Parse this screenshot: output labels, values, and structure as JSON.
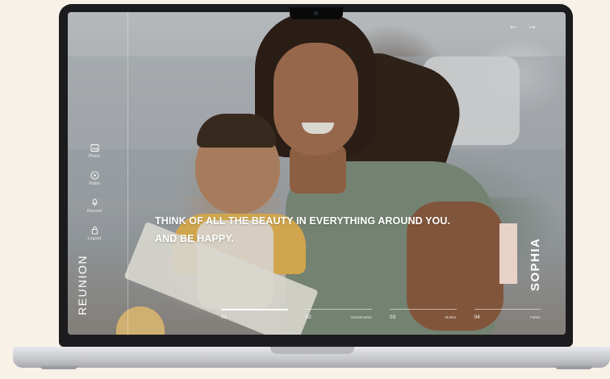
{
  "navigation": {
    "prev_icon": "arrow-left-icon",
    "next_icon": "arrow-right-icon"
  },
  "sidebar": {
    "items": [
      {
        "label": "Photo",
        "icon": "photo-icon"
      },
      {
        "label": "Video",
        "icon": "play-icon"
      },
      {
        "label": "Record",
        "icon": "microphone-icon"
      },
      {
        "label": "Logout",
        "icon": "lock-icon"
      }
    ]
  },
  "brand": {
    "logo_text": "REUNION"
  },
  "hero": {
    "line1": "THINK OF ALL THE BEAUTY IN EVERYTHING AROUND YOU.",
    "line2": "AND BE HAPPY."
  },
  "profile": {
    "name": "SOPHIA",
    "accent_color": "#e8d2c7"
  },
  "slides": [
    {
      "number": "01",
      "label": "",
      "active": true
    },
    {
      "number": "02",
      "label": "Grandmother",
      "active": false
    },
    {
      "number": "03",
      "label": "Mother",
      "active": false
    },
    {
      "number": "04",
      "label": "Father",
      "active": false
    }
  ]
}
